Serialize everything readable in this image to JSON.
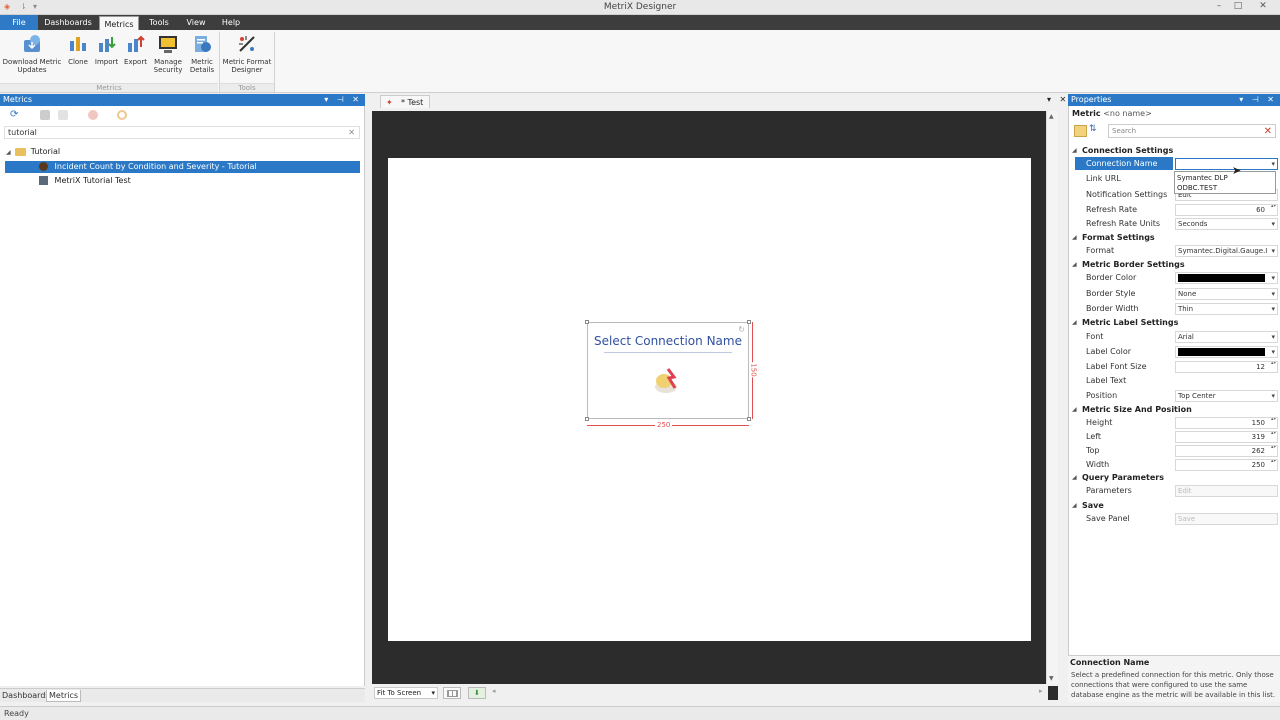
{
  "window": {
    "title": "MetriX Designer"
  },
  "menu": {
    "tabs": [
      "File",
      "Dashboards",
      "Metrics",
      "Tools",
      "View",
      "Help"
    ],
    "active": "Metrics"
  },
  "ribbon": {
    "buttons": [
      {
        "l1": "Download Metric",
        "l2": "Updates"
      },
      {
        "l1": "Clone",
        "l2": ""
      },
      {
        "l1": "Import",
        "l2": ""
      },
      {
        "l1": "Export",
        "l2": ""
      },
      {
        "l1": "Manage",
        "l2": "Security"
      },
      {
        "l1": "Metric",
        "l2": "Details"
      },
      {
        "l1": "Metric Format",
        "l2": "Designer"
      }
    ],
    "groups": [
      "Metrics",
      "Tools"
    ]
  },
  "left_panel": {
    "title": "Metrics",
    "search_value": "tutorial",
    "tree": {
      "folder": "Tutorial",
      "items": [
        "Incident Count by Condition and Severity - Tutorial",
        "MetriX Tutorial Test"
      ]
    },
    "tabs": [
      "Dashboards",
      "Metrics"
    ]
  },
  "document": {
    "tab_label": "* Test",
    "widget_title": "Select Connection Name",
    "dim_width": "250",
    "dim_height": "150",
    "zoom": "Fit To Screen"
  },
  "properties": {
    "title": "Properties",
    "object_label": "Metric",
    "object_name": "<no name>",
    "search_placeholder": "Search",
    "categories": {
      "connection": "Connection Settings",
      "format": "Format Settings",
      "border": "Metric Border Settings",
      "label": "Metric Label Settings",
      "size": "Metric Size And Position",
      "query": "Query Parameters",
      "save": "Save"
    },
    "rows": {
      "connection_name": "Connection Name",
      "link_url": "Link URL",
      "notification_settings": "Notification Settings",
      "notification_value": "Edit",
      "refresh_rate": "Refresh Rate",
      "refresh_rate_value": "60",
      "refresh_rate_units": "Refresh Rate Units",
      "refresh_rate_units_value": "Seconds",
      "format": "Format",
      "format_value": "Symantec.Digital.Gauge.I",
      "border_color": "Border Color",
      "border_style": "Border Style",
      "border_style_value": "None",
      "border_width": "Border Width",
      "border_width_value": "Thin",
      "font": "Font",
      "font_value": "Arial",
      "label_color": "Label Color",
      "label_font_size": "Label Font Size",
      "label_font_size_value": "12",
      "label_text": "Label Text",
      "position": "Position",
      "position_value": "Top Center",
      "height": "Height",
      "height_value": "150",
      "left": "Left",
      "left_value": "319",
      "top": "Top",
      "top_value": "262",
      "width": "Width",
      "width_value": "250",
      "parameters": "Parameters",
      "parameters_value": "Edit",
      "save_panel": "Save Panel",
      "save_panel_value": "Save"
    },
    "connection_options": [
      "Symantec DLP",
      "ODBC.TEST"
    ],
    "description_title": "Connection Name",
    "description_text": "Select a predefined connection for this metric.  Only those connections that were configured to use the same database engine as the metric will be available in this list."
  },
  "status": {
    "text": "Ready"
  },
  "colors": {
    "accent": "#2b79c6",
    "dark_canvas": "#2c2c2c",
    "menu_bar": "#3d3d3d"
  }
}
